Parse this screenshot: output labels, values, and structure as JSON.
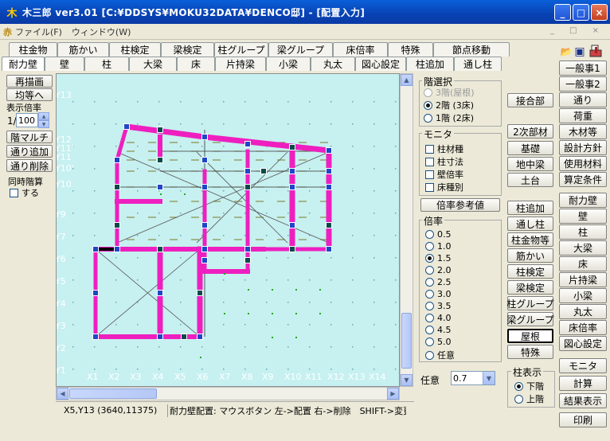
{
  "window": {
    "title": "木三郎 ver3.01 [C:¥DDSYS¥MOKU32DATA¥DENCO邸] - [配置入力]",
    "icon": "木",
    "minimize": "_",
    "maximize": "□",
    "close": "×"
  },
  "menu": {
    "items": [
      "ファイル(F)",
      "ウィンドウ(W)"
    ],
    "icon": "赤",
    "mdi_controls": "_ □ ×"
  },
  "tabs_row1": [
    "柱金物",
    "筋かい",
    "柱検定",
    "梁検定",
    "柱グループ",
    "梁グループ",
    "床倍率",
    "特殊",
    "節点移動"
  ],
  "tabs_row2": [
    "耐力壁",
    "壁",
    "柱",
    "大梁",
    "床",
    "片持梁",
    "小梁",
    "丸太",
    "図心設定",
    "柱追加",
    "通し柱"
  ],
  "left": {
    "redraw": "再描画",
    "equal": "均等へ",
    "display_scale_label": "表示倍率",
    "scale_prefix": "1/",
    "scale_value": "100",
    "multi": "階マルチ",
    "add_line": "通り追加",
    "del_line": "通り削除",
    "simul_label": "同時階算",
    "simul_check": "する"
  },
  "canvas": {
    "y_labels": [
      "Y13",
      "Y12",
      "Y11'",
      "Y11",
      "Y10'",
      "Y10",
      "Y9",
      "Y7",
      "Y6",
      "Y5",
      "Y4",
      "Y3",
      "Y2",
      "Y1"
    ],
    "x_labels": [
      "X1",
      "X2",
      "X3",
      "X4",
      "X5",
      "X6",
      "X7",
      "X8",
      "X9",
      "X10",
      "X11",
      "X12",
      "X13",
      "X14"
    ]
  },
  "status": {
    "coords": "X5,Y13 (3640,11375)",
    "message": "耐力壁配置: マウスボタン 左->配置 右->削除　SHIFT->変更"
  },
  "floor_select": {
    "title": "階選択",
    "options": [
      "3階(屋根)",
      "2階 (3床)",
      "1階 (2床)"
    ],
    "selected": 1
  },
  "monitor": {
    "title": "モニタ",
    "options": [
      "柱材種",
      "柱寸法",
      "壁倍率",
      "床種別"
    ]
  },
  "ratio_ref_button": "倍率参考値",
  "ratio": {
    "title": "倍率",
    "options": [
      "0.5",
      "1.0",
      "1.5",
      "2.0",
      "2.5",
      "3.0",
      "3.5",
      "4.0",
      "4.5",
      "5.0",
      "任意"
    ],
    "selected": 2,
    "arbitrary_label": "任意",
    "arbitrary_value": "0.7"
  },
  "mid_buttons": [
    "接合部",
    "2次部材",
    "基礎",
    "地中梁",
    "土台",
    "柱追加",
    "通し柱",
    "柱金物等",
    "筋かい",
    "柱検定",
    "梁検定",
    "柱グループ",
    "梁グループ",
    "屋根",
    "特殊"
  ],
  "mid_active": "屋根",
  "column_display": {
    "title": "柱表示",
    "options": [
      "下階",
      "上階"
    ],
    "selected": 0
  },
  "right_buttons": [
    "一般事1",
    "一般事2",
    "通り",
    "荷重",
    "木材等",
    "設計方針",
    "使用材料",
    "算定条件",
    "耐力壁",
    "壁",
    "柱",
    "大梁",
    "床",
    "片持梁",
    "小梁",
    "丸太",
    "床倍率",
    "図心設定",
    "モニタ",
    "計算",
    "結果表示",
    "印刷"
  ],
  "toolbar_icons": [
    "folder-open-icon",
    "save-icon",
    "print-icon"
  ],
  "colors": {
    "wall": "#ee1fbf",
    "canvas_bg": "#c7f0f0",
    "node_blue": "#2046c8",
    "node_dark": "#0c4a4a",
    "grid_dot": "#22aa22"
  }
}
